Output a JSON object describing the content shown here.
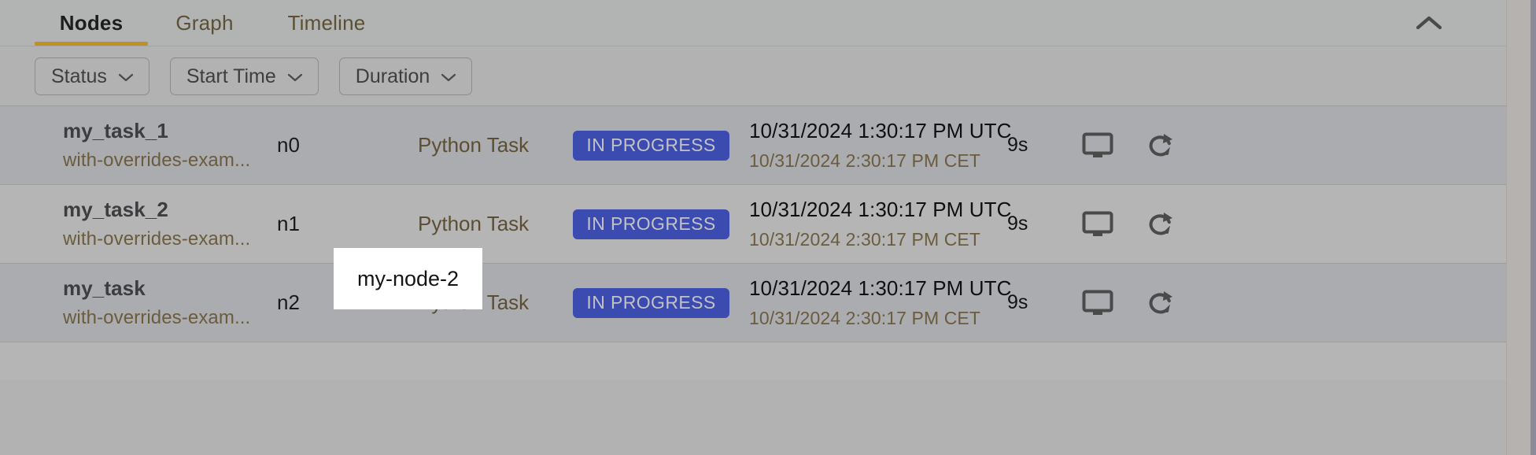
{
  "theme": {
    "accent_gold": "#bf9023",
    "badge_blue": "#3b4bb0",
    "panel_bg": "#b2b2b3",
    "row_bg": "#b5b5b6",
    "row_bg_dim": "#abacb0",
    "sub_text": "#6a5c3c"
  },
  "tabs": [
    {
      "label": "Nodes",
      "active": true,
      "icon": ""
    },
    {
      "label": "Graph",
      "active": false,
      "icon": ""
    },
    {
      "label": "Timeline",
      "active": false,
      "icon": ""
    }
  ],
  "collapse": {
    "icon": "chevron-up-icon"
  },
  "filters": [
    {
      "label": "Status",
      "icon": "chevron-down-icon"
    },
    {
      "label": "Start Time",
      "icon": "chevron-down-icon"
    },
    {
      "label": "Duration",
      "icon": "chevron-down-icon"
    }
  ],
  "node_tooltip": {
    "text": "my-node-2"
  },
  "rows": [
    {
      "name": "my_task_1",
      "subtitle": "with-overrides-exam...",
      "node": "n0",
      "type": "Python Task",
      "status": "IN PROGRESS",
      "time_utc": "10/31/2024 1:30:17 PM UTC",
      "time_local": "10/31/2024 2:30:17 PM CET",
      "duration": "9s",
      "actions": [
        "monitor-icon",
        "rerun-icon"
      ]
    },
    {
      "name": "my_task_2",
      "subtitle": "with-overrides-exam...",
      "node": "n1",
      "type": "Python Task",
      "status": "IN PROGRESS",
      "time_utc": "10/31/2024 1:30:17 PM UTC",
      "time_local": "10/31/2024 2:30:17 PM CET",
      "duration": "9s",
      "actions": [
        "monitor-icon",
        "rerun-icon"
      ]
    },
    {
      "name": "my_task",
      "subtitle": "with-overrides-exam...",
      "node": "n2",
      "type": "Python Task",
      "status": "IN PROGRESS",
      "time_utc": "10/31/2024 1:30:17 PM UTC",
      "time_local": "10/31/2024 2:30:17 PM CET",
      "duration": "9s",
      "actions": [
        "monitor-icon",
        "rerun-icon"
      ]
    }
  ]
}
